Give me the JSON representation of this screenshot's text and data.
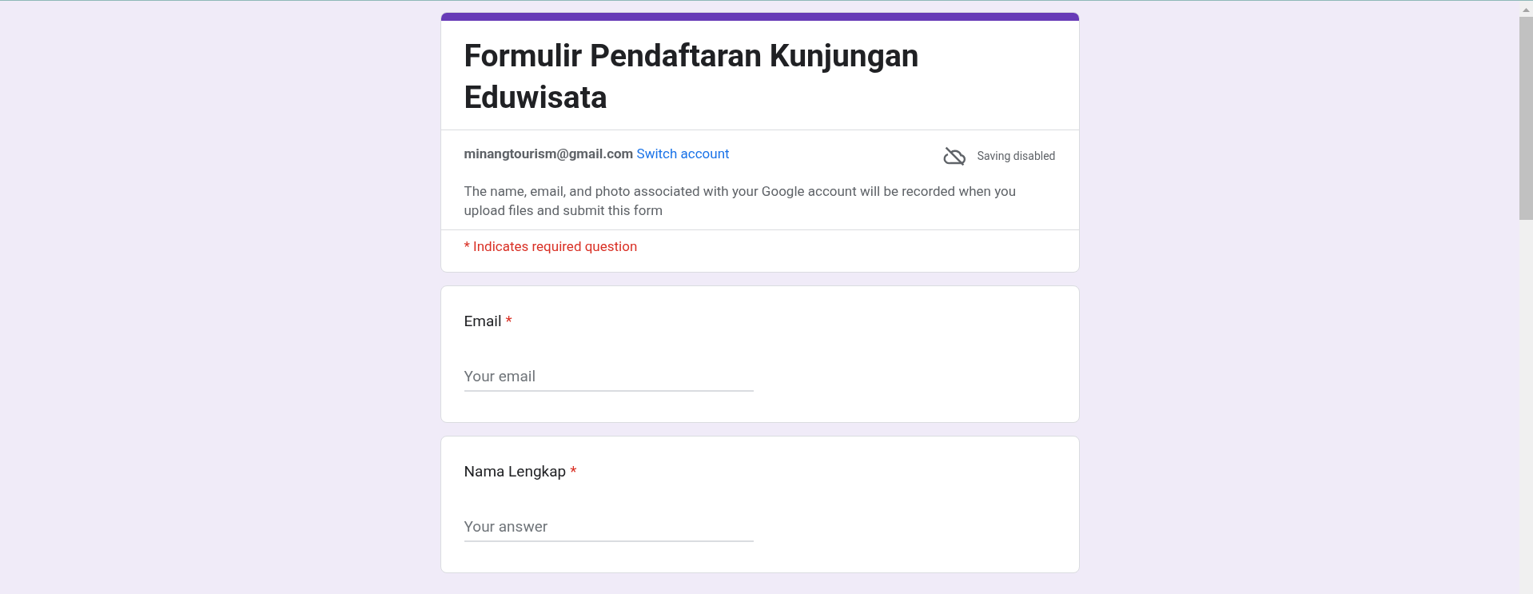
{
  "form": {
    "title": "Formulir Pendaftaran Kunjungan Eduwisata",
    "account_email": "minangtourism@gmail.com",
    "switch_account": "Switch account",
    "saving_status": "Saving disabled",
    "notice": "The name, email, and photo associated with your Google account will be recorded when you upload files and submit this form",
    "required_note": "* Indicates required question"
  },
  "questions": [
    {
      "label": "Email",
      "required": true,
      "required_mark": "*",
      "placeholder": "Your email"
    },
    {
      "label": "Nama Lengkap",
      "required": true,
      "required_mark": "*",
      "placeholder": "Your answer"
    }
  ]
}
